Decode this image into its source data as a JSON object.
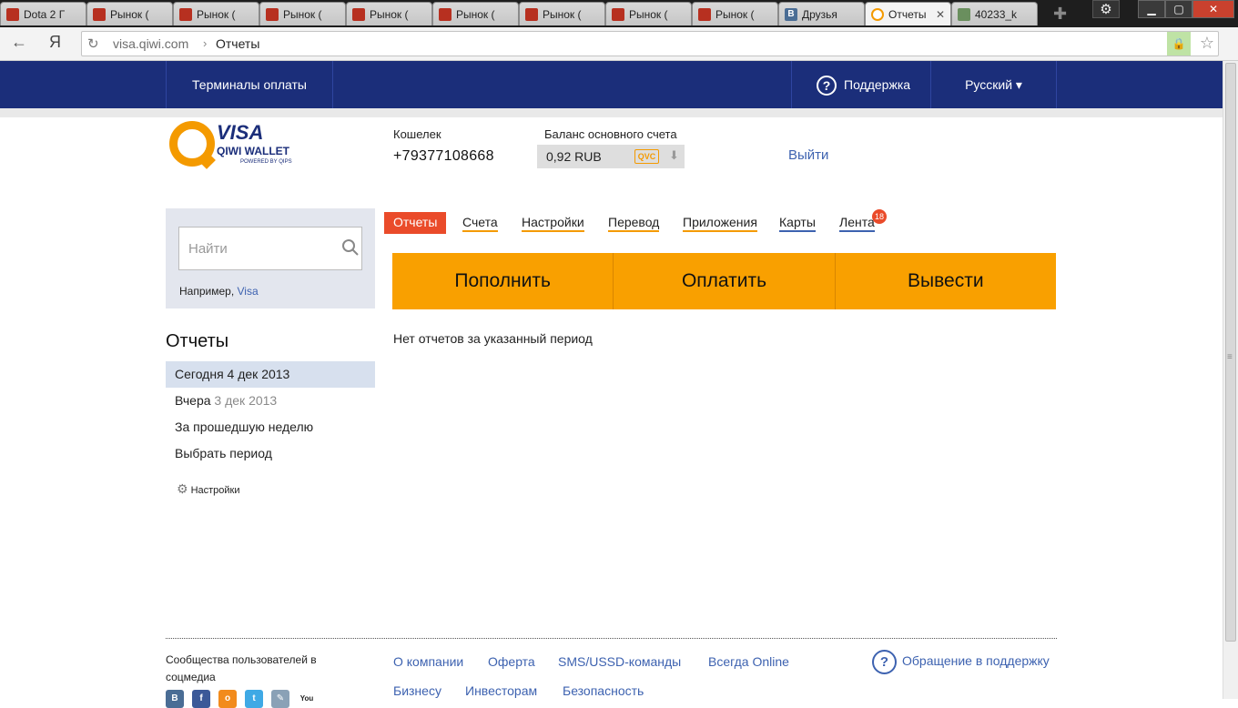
{
  "browser": {
    "tabs": [
      {
        "label": "Dota 2 Г",
        "icon": "dota-icon",
        "active": false
      },
      {
        "label": "Рынок (",
        "icon": "dota-icon",
        "active": false
      },
      {
        "label": "Рынок (",
        "icon": "dota-icon",
        "active": false
      },
      {
        "label": "Рынок (",
        "icon": "dota-icon",
        "active": false
      },
      {
        "label": "Рынок (",
        "icon": "dota-icon",
        "active": false
      },
      {
        "label": "Рынок (",
        "icon": "dota-icon",
        "active": false
      },
      {
        "label": "Рынок (",
        "icon": "dota-icon",
        "active": false
      },
      {
        "label": "Рынок (",
        "icon": "dota-icon",
        "active": false
      },
      {
        "label": "Рынок (",
        "icon": "dota-icon",
        "active": false
      },
      {
        "label": "Друзья",
        "icon": "vk-icon",
        "active": false
      },
      {
        "label": "Отчеты",
        "icon": "qiwi-icon",
        "active": true
      },
      {
        "label": "40233_k",
        "icon": "image-icon",
        "active": false
      }
    ],
    "url_host": "visa.qiwi.com",
    "url_sep": "›",
    "url_path": "Отчеты",
    "nav_ya": "Я"
  },
  "topnav": {
    "terminals": "Терминалы оплаты",
    "support": "Поддержка",
    "language": "Русский ▾"
  },
  "logo": {
    "visa": "VISA",
    "wallet": "QIWI WALLET",
    "powered": "POWERED BY QIPS"
  },
  "account": {
    "wallet_label": "Кошелек",
    "wallet_number": "+79377108668",
    "balance_label": "Баланс основного счета",
    "balance_amount": "0,92 RUB",
    "balance_badge": "QVC",
    "logout": "Выйти"
  },
  "search": {
    "placeholder": "Найти",
    "example_prefix": "Например,",
    "example_link": "Visa"
  },
  "sidebar": {
    "title": "Отчеты",
    "items": [
      {
        "label": "Сегодня 4 дек 2013",
        "dim": "",
        "selected": true
      },
      {
        "label": "Вчера",
        "dim": "3 дек 2013",
        "selected": false
      },
      {
        "label": "За прошедшую неделю",
        "dim": "",
        "selected": false
      },
      {
        "label": "Выбрать период",
        "dim": "",
        "selected": false
      }
    ],
    "settings": "Настройки"
  },
  "main_tabs": {
    "reports": "Отчеты",
    "accounts": "Счета",
    "settings": "Настройки",
    "transfer": "Перевод",
    "apps": "Приложения",
    "cards": "Карты",
    "feed": "Лента",
    "feed_badge": "18"
  },
  "actions": {
    "topup": "Пополнить",
    "pay": "Оплатить",
    "withdraw": "Вывести"
  },
  "empty_message": "Нет отчетов за указанный период",
  "footer": {
    "social_title": "Сообщества пользователей в соцмедиа",
    "links_row1": [
      "О компании",
      "Оферта",
      "SMS/USSD-команды",
      "Всегда Online"
    ],
    "links_row2": [
      "Бизнесу",
      "Инвесторам",
      "Безопасность"
    ],
    "support": "Обращение в поддержку",
    "social_icons": [
      "vk-icon",
      "facebook-icon",
      "odnoklassniki-icon",
      "twitter-icon",
      "blog-icon",
      "youtube-icon"
    ],
    "youtube": "You"
  },
  "colors": {
    "brand_blue": "#1b2e7a",
    "brand_orange": "#f9a000",
    "link_blue": "#3d62b0",
    "active_tab_red": "#ea4b2a"
  }
}
